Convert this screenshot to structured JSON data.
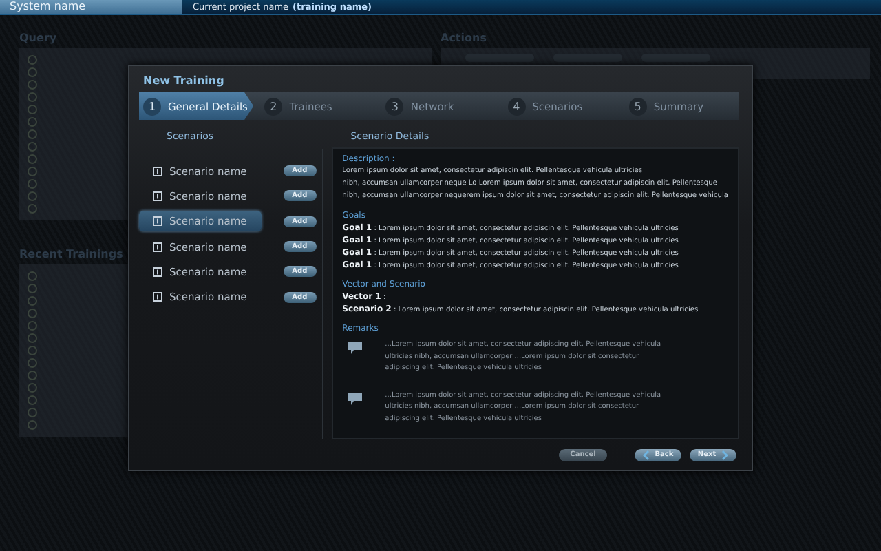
{
  "top_bar": {
    "system_name": "System name",
    "project_label": "Current project name",
    "project_name": "(training name)"
  },
  "background": {
    "query_title": "Query",
    "actions_title": "Actions",
    "recent_title": "Recent Trainings"
  },
  "dialog": {
    "title": "New Training",
    "steps": [
      {
        "number": "1",
        "label": "General Details",
        "selected": true
      },
      {
        "number": "2",
        "label": "Trainees",
        "selected": false
      },
      {
        "number": "3",
        "label": "Network",
        "selected": false
      },
      {
        "number": "4",
        "label": "Scenarios",
        "selected": false
      },
      {
        "number": "5",
        "label": "Summary",
        "selected": false
      }
    ],
    "scenarios_title": "Scenarios",
    "scenarios": [
      {
        "name": "Scenario name",
        "selected": false,
        "action": "Add"
      },
      {
        "name": "Scenario name",
        "selected": false,
        "action": "Add"
      },
      {
        "name": "Scenario name",
        "selected": true,
        "action": "Add"
      },
      {
        "name": "Scenario name",
        "selected": false,
        "action": "Add"
      },
      {
        "name": "Scenario name",
        "selected": false,
        "action": "Add"
      },
      {
        "name": "Scenario name",
        "selected": false,
        "action": "Add"
      }
    ],
    "details_title": "Scenario Details",
    "description_title": "Description :",
    "description_lines": [
      "Lorem ipsum dolor sit amet, consectetur adipiscin elit. Pellentesque vehicula ultricies",
      "nibh, accumsan ullamcorper neque Lo Lorem ipsum dolor sit amet, consectetur adipiscin elit. Pellentesque",
      "nibh, accumsan ullamcorper nequerem ipsum dolor sit amet, consectetur adipiscin elit. Pellentesque vehicula"
    ],
    "goals_title": "Goals",
    "goals": [
      "**Goal 1** : Lorem ipsum dolor sit amet, consectetur adipiscin elit. Pellentesque vehicula ultricies",
      "**Goal 1** : Lorem ipsum dolor sit amet, consectetur adipiscin elit. Pellentesque vehicula ultricies",
      "**Goal 1** : Lorem ipsum dolor sit amet, consectetur adipiscin elit. Pellentesque vehicula ultricies",
      "**Goal 1** : Lorem ipsum dolor sit amet, consectetur adipiscin elit. Pellentesque vehicula ultricies"
    ],
    "vector_title": "Vector and Scenario",
    "vector_lines": [
      "**Vector 1** :",
      "**Scenario 2** : Lorem ipsum dolor sit amet, consectetur adipiscin elit. Pellentesque vehicula ultricies"
    ],
    "remarks_title": "Remarks",
    "remarks": [
      "...Lorem ipsum dolor sit amet, consectetur adipiscing elit. Pellentesque vehicula ultricies nibh, accumsan ullamcorper ...Lorem ipsum dolor sit consectetur adipiscing elit. Pellentesque vehicula ultricies",
      "...Lorem ipsum dolor sit amet, consectetur adipiscing elit. Pellentesque vehicula ultricies nibh, accumsan ullamcorper ...Lorem ipsum dolor sit consectetur adipiscing elit. Pellentesque vehicula ultricies"
    ],
    "buttons": [
      {
        "kind": "cancel",
        "label": "Cancel"
      },
      {
        "kind": "back",
        "label": "Back"
      },
      {
        "kind": "next",
        "label": "Next"
      }
    ]
  }
}
